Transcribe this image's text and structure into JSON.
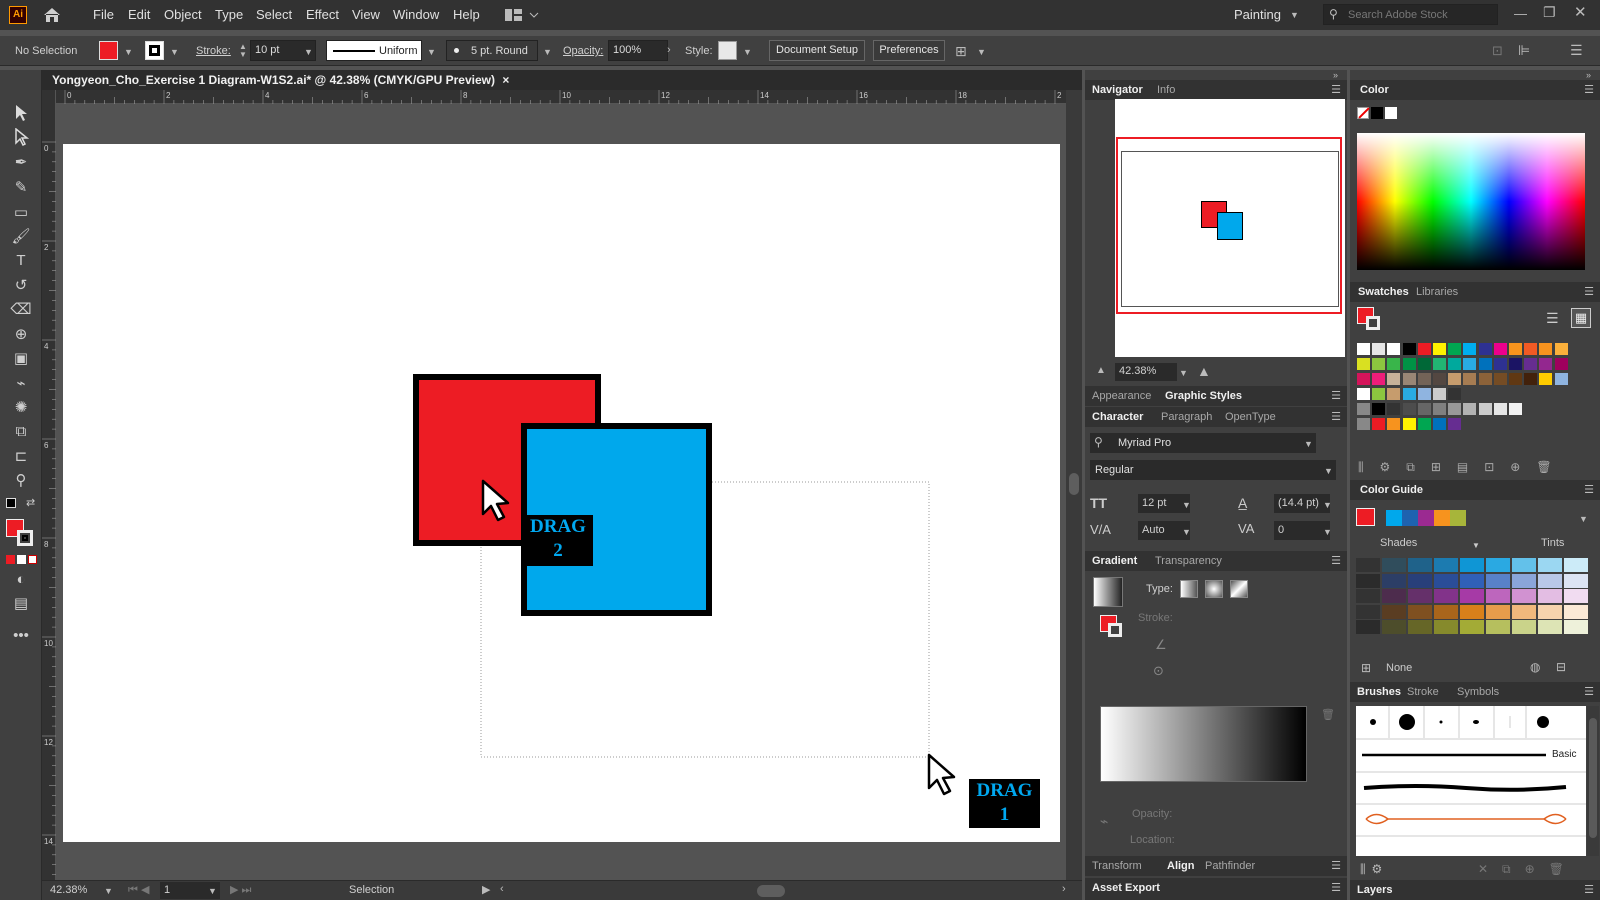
{
  "app": {
    "logo": "Ai"
  },
  "menu": [
    "File",
    "Edit",
    "Object",
    "Type",
    "Select",
    "Effect",
    "View",
    "Window",
    "Help"
  ],
  "workspace": {
    "label": "Painting",
    "search_placeholder": "Search Adobe Stock"
  },
  "control": {
    "selection": "No Selection",
    "stroke_label": "Stroke:",
    "stroke_value": "10 pt",
    "profile": "Uniform",
    "brush": "5 pt. Round",
    "opacity_label": "Opacity:",
    "opacity_value": "100%",
    "style_label": "Style:",
    "document_setup": "Document Setup",
    "preferences": "Preferences"
  },
  "document": {
    "title": "Yongyeon_Cho_Exercise 1 Diagram-W1S2.ai* @ 42.38% (CMYK/GPU Preview)",
    "close": "×"
  },
  "ruler_h": [
    "0",
    "2",
    "4",
    "6",
    "8",
    "10",
    "12",
    "14",
    "16",
    "18",
    "2"
  ],
  "ruler_v": [
    "0",
    "2",
    "4",
    "6",
    "8",
    "10",
    "12",
    "14"
  ],
  "canvas": {
    "drag2": [
      "DRAG",
      "2"
    ],
    "drag1": [
      "DRAG",
      "1"
    ]
  },
  "status": {
    "zoom": "42.38%",
    "artboard": "1",
    "mode": "Selection"
  },
  "navigator": {
    "tab1": "Navigator",
    "tab2": "Info",
    "zoom": "42.38%"
  },
  "appearance": {
    "tab1": "Appearance",
    "tab2": "Graphic Styles"
  },
  "character": {
    "tab1": "Character",
    "tab2": "Paragraph",
    "tab3": "OpenType",
    "font": "Myriad Pro",
    "style": "Regular",
    "size": "12 pt",
    "leading": "(14.4 pt)",
    "kerning": "Auto",
    "tracking": "0"
  },
  "gradient": {
    "tab1": "Gradient",
    "tab2": "Transparency",
    "type_label": "Type:",
    "stroke_label": "Stroke:",
    "opacity_label": "Opacity:",
    "location_label": "Location:"
  },
  "bottom_tabs": {
    "transform": "Transform",
    "align": "Align",
    "pathfinder": "Pathfinder",
    "asset_export": "Asset Export"
  },
  "color": {
    "tab": "Color"
  },
  "swatches": {
    "tab1": "Swatches",
    "tab2": "Libraries"
  },
  "color_guide": {
    "tab": "Color Guide",
    "shades": "Shades",
    "tints": "Tints",
    "none": "None"
  },
  "brushes": {
    "tab1": "Brushes",
    "tab2": "Stroke",
    "tab3": "Symbols",
    "basic": "Basic"
  },
  "layers": {
    "tab": "Layers"
  },
  "colors": {
    "red": "#ed1c24",
    "blue": "#00a8ec",
    "black": "#000000"
  }
}
